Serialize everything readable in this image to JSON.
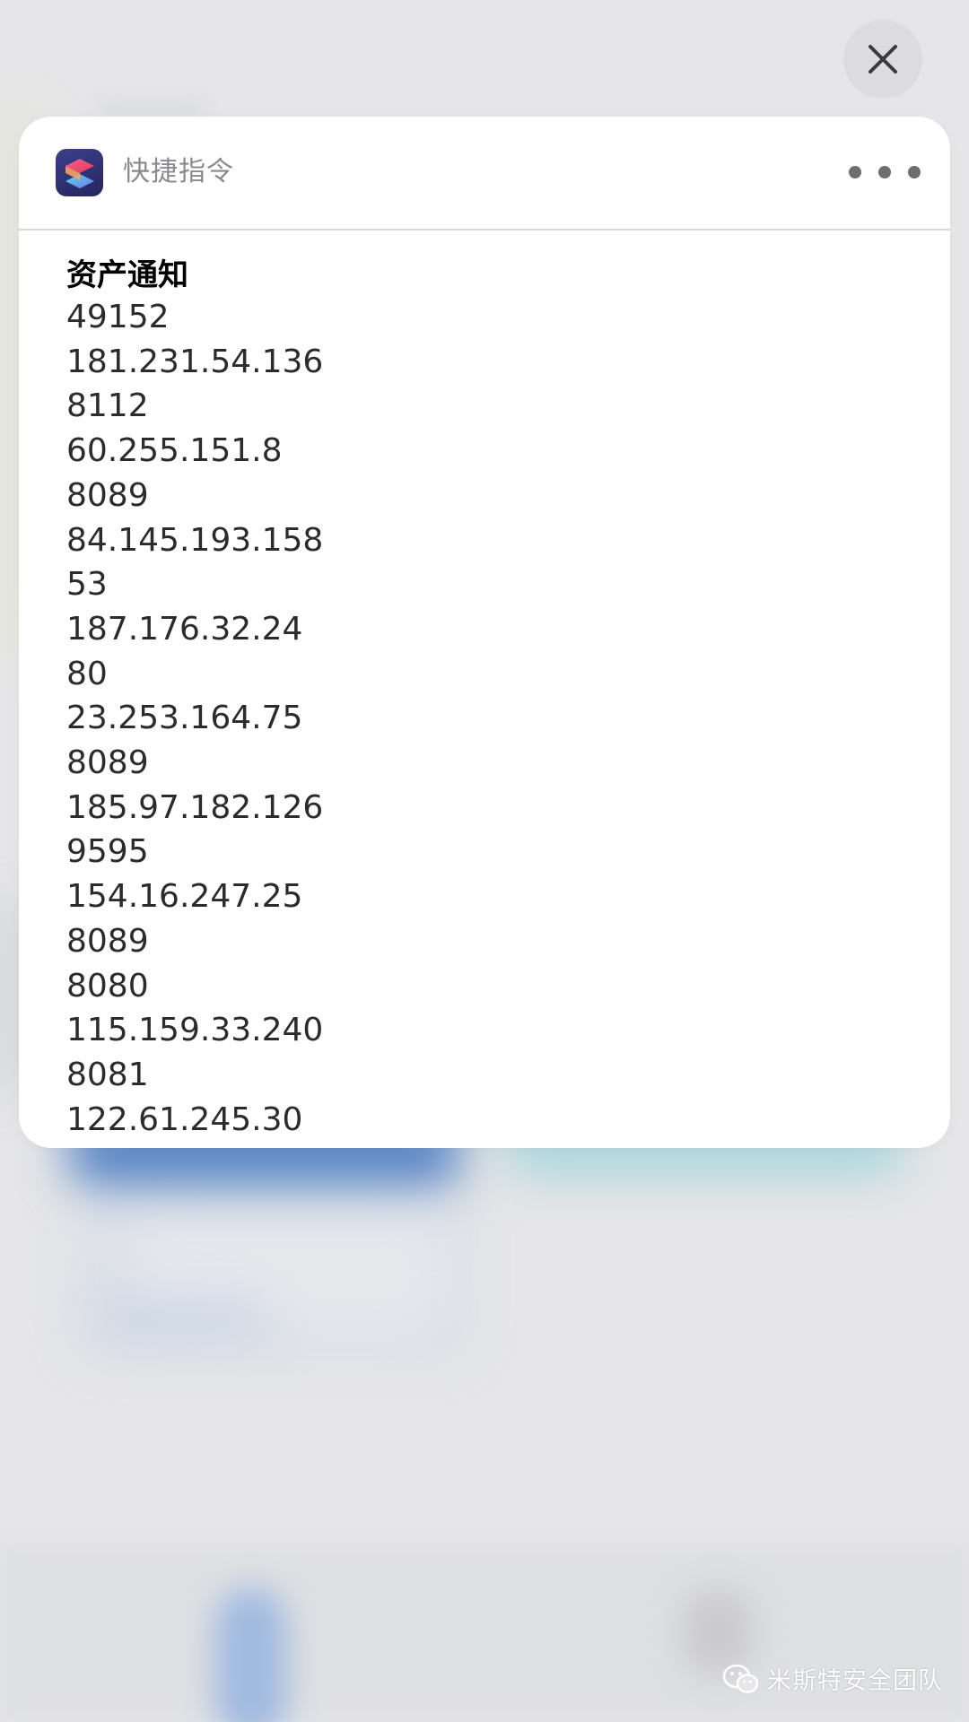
{
  "close_button": {
    "icon": "close-icon"
  },
  "notification": {
    "app_name": "快捷指令",
    "app_icon": "shortcuts-app-icon",
    "more_icon": "ellipsis-icon",
    "title": "资产通知",
    "lines": [
      "49152",
      "181.231.54.136",
      "8112",
      "60.255.151.8",
      "8089",
      "84.145.193.158",
      "53",
      "187.176.32.24",
      "80",
      "23.253.164.75",
      "8089",
      "185.97.182.126",
      "9595",
      "154.16.247.25",
      "8089",
      "8080",
      "115.159.33.240",
      "8081",
      "122.61.245.30"
    ]
  },
  "watermark": {
    "icon": "wechat-icon",
    "text": "米斯特安全团队"
  },
  "colors": {
    "background": "#e6e6e8",
    "card": "#ffffff",
    "app_name_text": "#8a8a8e",
    "body_text": "#2b2b2b"
  }
}
